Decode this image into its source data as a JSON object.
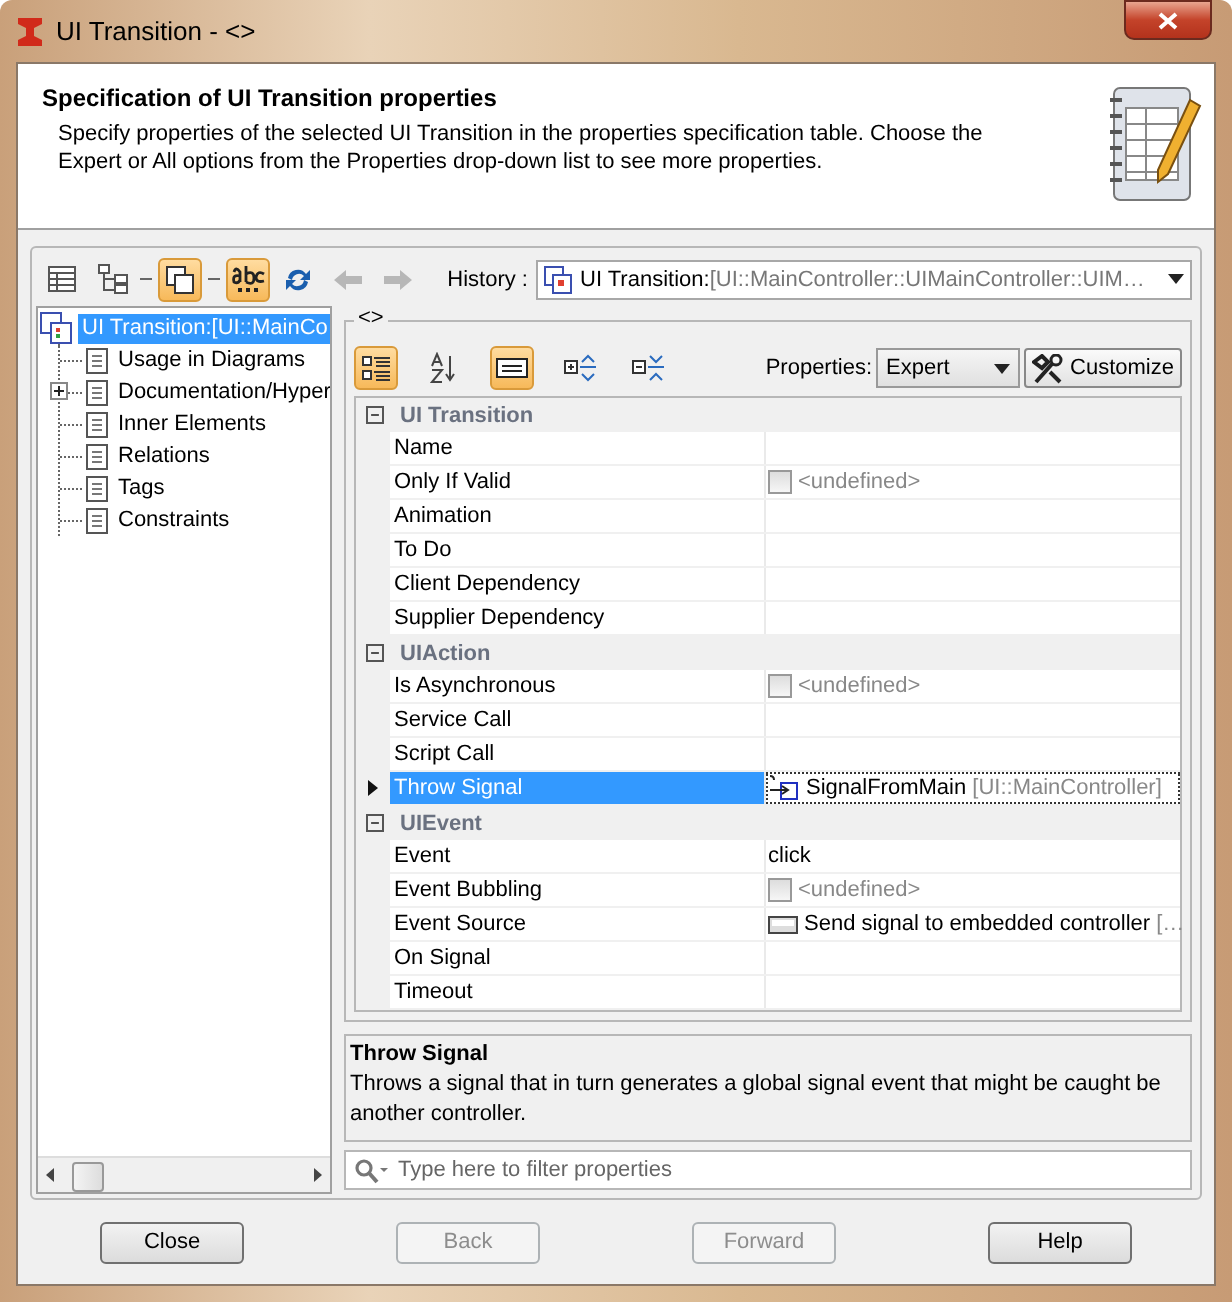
{
  "window": {
    "title": "UI Transition - <>"
  },
  "header": {
    "title": "Specification of UI Transition properties",
    "description": "Specify properties of the selected UI Transition in the properties specification table. Choose the Expert or All options from the Properties drop-down list to see more properties."
  },
  "toolbar": [
    {
      "kind": "table",
      "on": false,
      "disabled": false
    },
    {
      "kind": "tree",
      "on": false,
      "disabled": false
    },
    {
      "kind": "separator"
    },
    {
      "kind": "copy",
      "on": true,
      "disabled": false
    },
    {
      "kind": "separator"
    },
    {
      "kind": "abc",
      "on": true,
      "disabled": false
    },
    {
      "kind": "refresh",
      "on": false,
      "disabled": false
    },
    {
      "kind": "back",
      "on": false,
      "disabled": true
    },
    {
      "kind": "forward",
      "on": false,
      "disabled": true
    }
  ],
  "history": {
    "label": "History :",
    "value": "UI Transition:",
    "detail": "[UI::MainController::UIMainController::UIM…"
  },
  "tree": {
    "items": [
      {
        "label": "UI Transition:[UI::MainCo",
        "selected": true,
        "children": [
          {
            "label": "Usage in Diagrams",
            "selected": false,
            "kind": "leaf"
          },
          {
            "label": "Documentation/Hyper",
            "selected": false,
            "kind": "group",
            "expanded": false
          },
          {
            "label": "Inner Elements",
            "selected": false,
            "kind": "leaf"
          },
          {
            "label": "Relations",
            "selected": false,
            "kind": "leaf"
          },
          {
            "label": "Tags",
            "selected": false,
            "kind": "leaf"
          },
          {
            "label": "Constraints",
            "selected": false,
            "kind": "leaf"
          }
        ]
      }
    ]
  },
  "panel": {
    "title": "<>"
  },
  "property_toolbar": [
    {
      "kind": "categorized",
      "on": true
    },
    {
      "kind": "sort",
      "on": false
    },
    {
      "kind": "description",
      "on": true
    },
    {
      "kind": "expand",
      "on": false
    },
    {
      "kind": "collapse",
      "on": false
    }
  ],
  "properties": {
    "label": "Properties:",
    "value": "Expert",
    "customize": "Customize"
  },
  "groups": [
    {
      "name": "UI Transition",
      "expanded": true,
      "rows": [
        {
          "name": "Name",
          "kind": "text",
          "selected": false
        },
        {
          "name": "Only If Valid",
          "kind": "checkbox",
          "checked": false,
          "value": "<undefined>",
          "selected": false
        },
        {
          "name": "Animation",
          "kind": "text",
          "selected": false
        },
        {
          "name": "To Do",
          "kind": "text",
          "selected": false
        },
        {
          "name": "Client Dependency",
          "kind": "text",
          "selected": false
        },
        {
          "name": "Supplier Dependency",
          "kind": "text",
          "selected": false
        }
      ]
    },
    {
      "name": "UIAction",
      "expanded": true,
      "rows": [
        {
          "name": "Is Asynchronous",
          "kind": "checkbox",
          "checked": false,
          "value": "<undefined>",
          "selected": false
        },
        {
          "name": "Service Call",
          "kind": "text",
          "selected": false
        },
        {
          "name": "Script Call",
          "kind": "text",
          "selected": false
        },
        {
          "name": "Throw Signal",
          "kind": "signal",
          "value": "SignalFromMain",
          "detail": "[UI::MainController]",
          "selected": true
        }
      ]
    },
    {
      "name": "UIEvent",
      "expanded": true,
      "rows": [
        {
          "name": "Event",
          "kind": "text",
          "value": "click",
          "selected": false
        },
        {
          "name": "Event Bubbling",
          "kind": "checkbox",
          "checked": false,
          "value": "<undefined>",
          "selected": false
        },
        {
          "name": "Event Source",
          "kind": "button",
          "value": "Send signal to embedded controller",
          "detail": "[…",
          "selected": false
        },
        {
          "name": "On Signal",
          "kind": "text",
          "selected": false
        },
        {
          "name": "Timeout",
          "kind": "text",
          "selected": false
        }
      ]
    }
  ],
  "description": {
    "title": "Throw Signal",
    "text": "Throws a signal that in turn generates a global signal event that might be caught be another controller."
  },
  "filter": {
    "placeholder": "Type here to filter properties"
  },
  "buttons": [
    {
      "label": "Close",
      "disabled": false
    },
    {
      "label": "Back",
      "disabled": true
    },
    {
      "label": "Forward",
      "disabled": true
    },
    {
      "label": "Help",
      "disabled": false
    }
  ]
}
